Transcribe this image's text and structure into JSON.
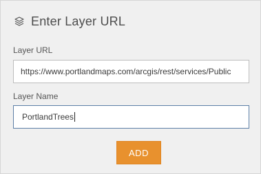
{
  "header": {
    "icon": "layers-icon",
    "title": "Enter Layer URL"
  },
  "form": {
    "layer_url": {
      "label": "Layer URL",
      "value": "https://www.portlandmaps.com/arcgis/rest/services/Public"
    },
    "layer_name": {
      "label": "Layer Name",
      "value": "PortlandTrees"
    }
  },
  "actions": {
    "add_label": "ADD"
  },
  "colors": {
    "accent": "#e8912e",
    "panel_bg": "#f0f0f0",
    "focus_border": "#5b7ea6"
  }
}
